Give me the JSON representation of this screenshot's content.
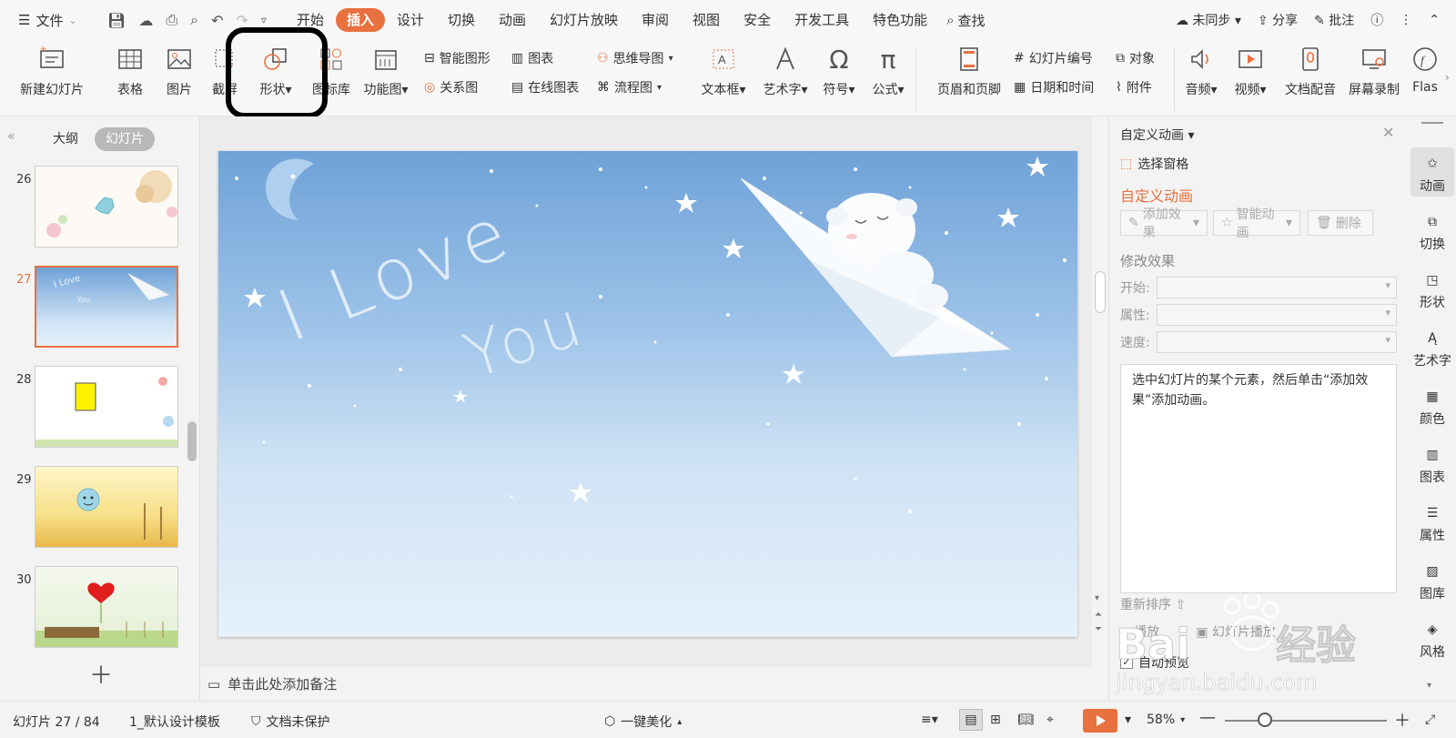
{
  "menubar": {
    "file_label": "文件",
    "tabs": [
      "开始",
      "插入",
      "设计",
      "切换",
      "动画",
      "幻灯片放映",
      "审阅",
      "视图",
      "安全",
      "开发工具",
      "特色功能"
    ],
    "active_tab": "插入",
    "search_label": "查找",
    "sync_label": "未同步",
    "share_label": "分享",
    "comment_label": "批注"
  },
  "ribbon": {
    "new_slide": "新建幻灯片",
    "table": "表格",
    "picture": "图片",
    "screenshot": "截屏",
    "shape": "形状",
    "icon_library": "图标库",
    "function_chart": "功能图",
    "smart_art": "智能图形",
    "chart": "图表",
    "relation_chart": "关系图",
    "online_chart": "在线图表",
    "mind_map": "思维导图",
    "flow_chart": "流程图",
    "text_box": "文本框",
    "word_art": "艺术字",
    "symbol": "符号",
    "formula": "公式",
    "header_footer": "页眉和页脚",
    "slide_number": "幻灯片编号",
    "object": "对象",
    "date_time": "日期和时间",
    "attachment": "附件",
    "audio": "音频",
    "video": "视频",
    "doc_voiceover": "文档配音",
    "screen_record": "屏幕录制",
    "flash": "Flas"
  },
  "leftpanel": {
    "tab_outline": "大纲",
    "tab_slides": "幻灯片",
    "slides": [
      {
        "num": "26"
      },
      {
        "num": "27"
      },
      {
        "num": "28"
      },
      {
        "num": "29"
      },
      {
        "num": "30"
      }
    ],
    "active_slide": "27"
  },
  "slide": {
    "text1": "I Love",
    "text2": "You"
  },
  "notes": {
    "placeholder": "单击此处添加备注"
  },
  "rpanel": {
    "title": "自定义动画",
    "select_pane": "选择窗格",
    "heading": "自定义动画",
    "add_effect": "添加效果",
    "smart_anim": "智能动画",
    "delete": "删除",
    "modify": "修改效果",
    "start_label": "开始:",
    "prop_label": "属性:",
    "speed_label": "速度:",
    "hint": "选中幻灯片的某个元素，然后单击“添加效果”添加动画。",
    "reorder": "重新排序",
    "play": "播放",
    "slideshow": "幻灯片播放",
    "auto_preview": "自动预览"
  },
  "sidetool": {
    "items": [
      "动画",
      "切换",
      "形状",
      "艺术字",
      "颜色",
      "图表",
      "属性",
      "图库",
      "风格"
    ]
  },
  "status": {
    "slide_count": "幻灯片 27 / 84",
    "template": "1_默认设计模板",
    "protect": "文档未保护",
    "beautify": "一键美化",
    "zoom": "58%"
  },
  "watermark": {
    "brand": "Bai",
    "brand2": "经验",
    "url": "jingyan.baidu.com"
  },
  "colors": {
    "accent": "#e9703f",
    "highlight_box": "#000000"
  }
}
